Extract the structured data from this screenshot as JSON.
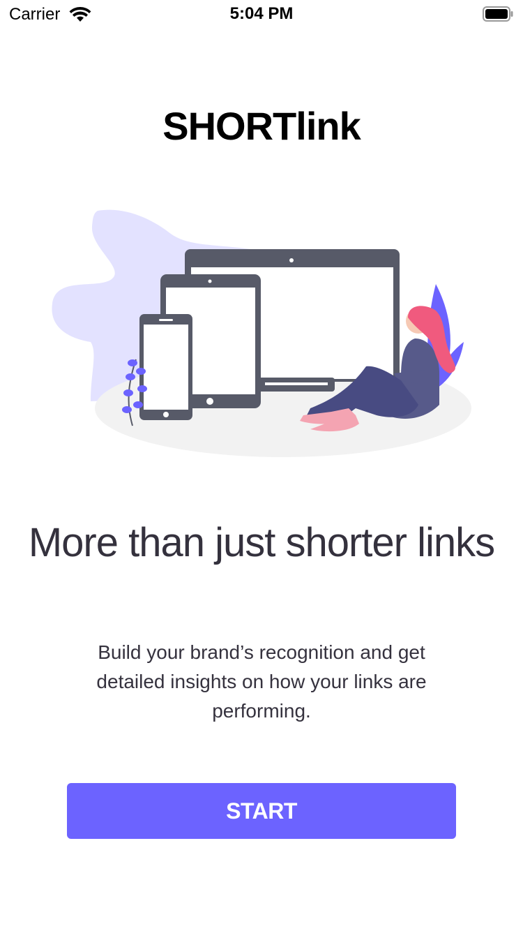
{
  "status_bar": {
    "carrier": "Carrier",
    "time": "5:04 PM",
    "icons": [
      "wifi-icon",
      "battery-icon"
    ]
  },
  "logo": "SHORTlink",
  "illustration": {
    "subject": "devices-illustration",
    "colors": {
      "blob": "#e3e2ff",
      "device": "#575a68",
      "accent": "#6c63ff",
      "hair": "#f05a7e",
      "shoes": "#f4a4b2",
      "floor": "#f2f2f2"
    }
  },
  "headline": "More than just shorter links",
  "subtext": "Build your brand’s recognition and get detailed insights on how your links are performing.",
  "start_button": {
    "label": "START",
    "color": "#6c63ff"
  }
}
